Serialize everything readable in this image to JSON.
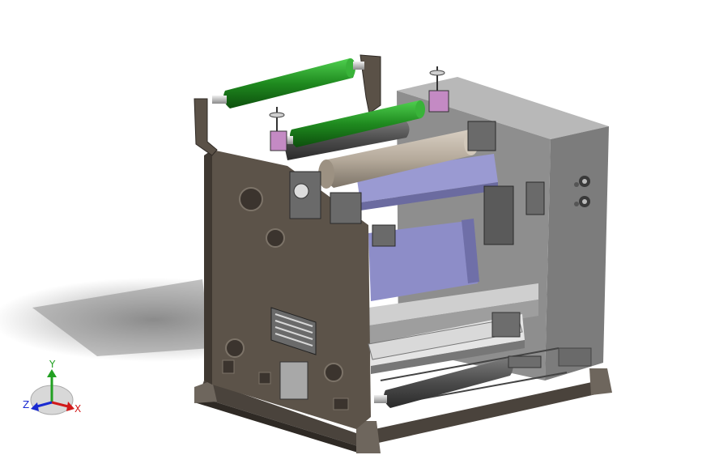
{
  "triad": {
    "x_label": "X",
    "y_label": "Y",
    "z_label": "Z",
    "x_color": "#d11a1a",
    "y_color": "#22a022",
    "z_color": "#1a2bd1"
  },
  "colors": {
    "frame": "#5a5147",
    "frame_dark": "#3f3831",
    "cabinet": "#8c8c8c",
    "cabinet_dark": "#6e6e6e",
    "roller_green": "#1f8a1f",
    "roller_tan": "#b6ab9c",
    "roller_dark": "#4b4b4b",
    "blue_panel": "#8c8cc4",
    "shadow": "#8a8a8a"
  }
}
